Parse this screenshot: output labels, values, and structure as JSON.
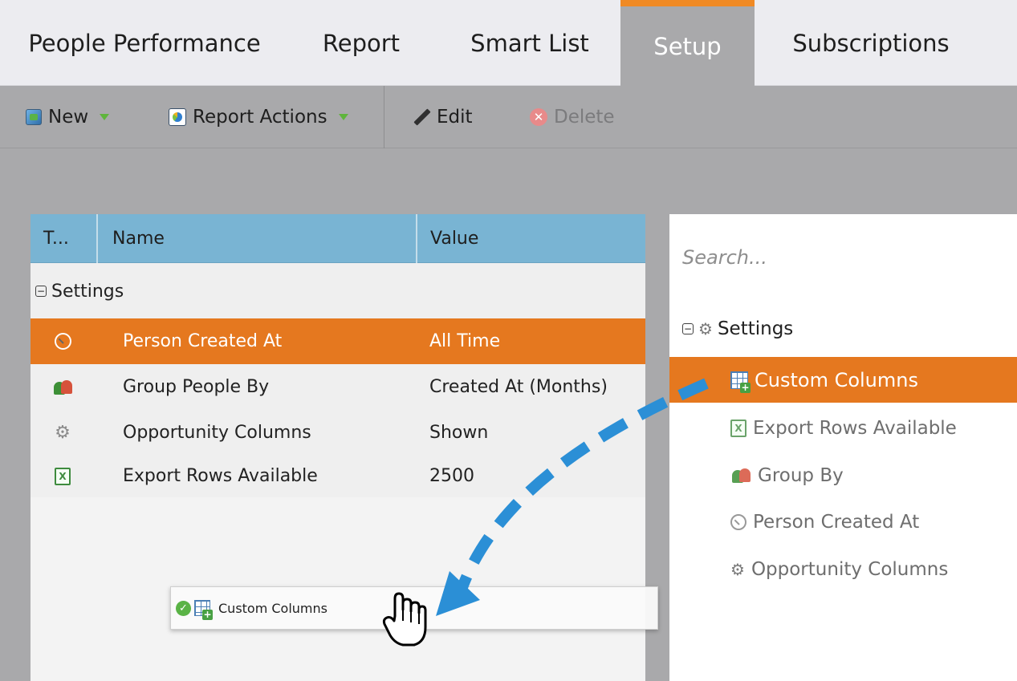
{
  "tabs": [
    {
      "label": "People Performance",
      "active": false
    },
    {
      "label": "Report",
      "active": false
    },
    {
      "label": "Smart List",
      "active": false
    },
    {
      "label": "Setup",
      "active": true
    },
    {
      "label": "Subscriptions",
      "active": false
    }
  ],
  "toolbar": {
    "new_label": "New",
    "report_actions_label": "Report Actions",
    "edit_label": "Edit",
    "delete_label": "Delete"
  },
  "grid": {
    "columns": [
      "T...",
      "Name",
      "Value"
    ],
    "group_label": "Settings",
    "rows": [
      {
        "icon": "clock-icon",
        "name": "Person Created At",
        "value": "All Time",
        "selected": true
      },
      {
        "icon": "people-icon",
        "name": "Group People By",
        "value": "Created At (Months)",
        "selected": false
      },
      {
        "icon": "gear-icon",
        "name": "Opportunity Columns",
        "value": "Shown",
        "selected": false
      },
      {
        "icon": "excel-icon",
        "name": "Export Rows Available",
        "value": "2500",
        "selected": false
      }
    ]
  },
  "tree": {
    "search_placeholder": "Search...",
    "group_label": "Settings",
    "items": [
      {
        "icon": "custom-columns-icon",
        "label": "Custom Columns",
        "selected": true
      },
      {
        "icon": "excel-icon",
        "label": "Export Rows Available",
        "selected": false
      },
      {
        "icon": "people-icon",
        "label": "Group By",
        "selected": false
      },
      {
        "icon": "clock-icon",
        "label": "Person Created At",
        "selected": false
      },
      {
        "icon": "gear-icon",
        "label": "Opportunity Columns",
        "selected": false
      }
    ]
  },
  "drag_ghost": {
    "label": "Custom Columns",
    "status_icon": "check-icon",
    "cursor_icon": "hand-cursor-icon"
  },
  "colors": {
    "accent_orange": "#e5781f",
    "tab_highlight": "#f08a24",
    "grid_header": "#79b4d3",
    "arrow_blue": "#2b8fd6"
  }
}
